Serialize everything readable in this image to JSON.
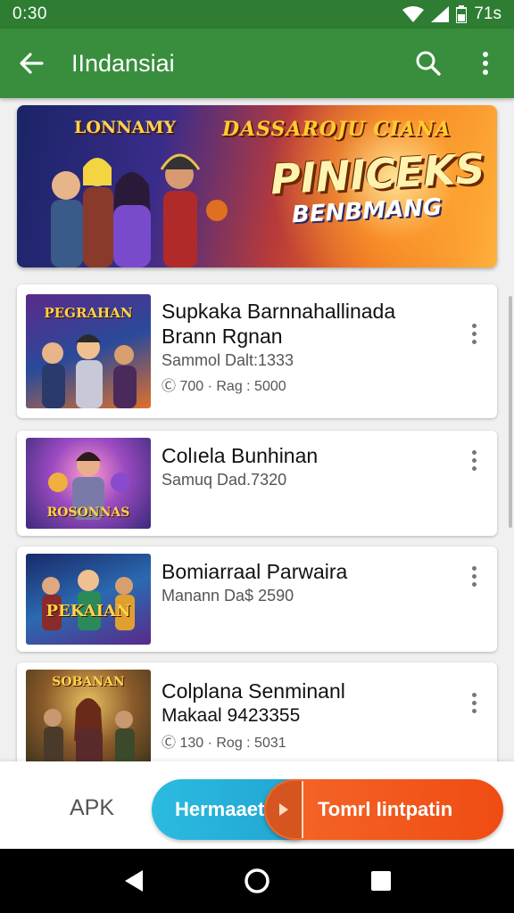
{
  "status_bar": {
    "time": "0:30",
    "battery_text": "71s"
  },
  "app_bar": {
    "title": "IIndansiai"
  },
  "banner": {
    "logo_text": "LONNAMY",
    "top_text": "DASSAROJU CIANA",
    "title": "PINICEKS",
    "subtitle": "BENBMANG"
  },
  "cards": [
    {
      "name": "Supkaka Barnnahallinada",
      "name2": "Brann Rgnan",
      "sub": "Sammol Dalt:1333",
      "meta": "Ⓒ 700 · Rag : 5000",
      "thumb_text": "PEGRAHAN"
    },
    {
      "name": "Colıela Bunhinan",
      "sub": "Samuq Dad.7320",
      "thumb_text": "ROSONNAS"
    },
    {
      "name": "Bomiarraal Parwaira",
      "sub": "Manann Da$ 2590",
      "thumb_text": "PEKAIAN"
    },
    {
      "name": "Colplana Senminanl",
      "name2": "Makaal 9423355",
      "meta": "Ⓒ 130 · Rog : 5031",
      "thumb_text": "SOBANAN"
    }
  ],
  "bottom_bar": {
    "apk_label": "APK",
    "secondary_button": "Hermaaet",
    "primary_button": "Tomrl Iintpatin"
  },
  "colors": {
    "status_bar": "#2e7d32",
    "app_bar": "#388e3c",
    "primary_button": "#f25a1e",
    "secondary_button": "#27b3da"
  },
  "icons": {
    "back": "arrow-left-icon",
    "search": "search-icon",
    "more": "more-vert-icon",
    "nav_back": "triangle-back-icon",
    "nav_home": "circle-home-icon",
    "nav_recents": "square-recents-icon"
  }
}
